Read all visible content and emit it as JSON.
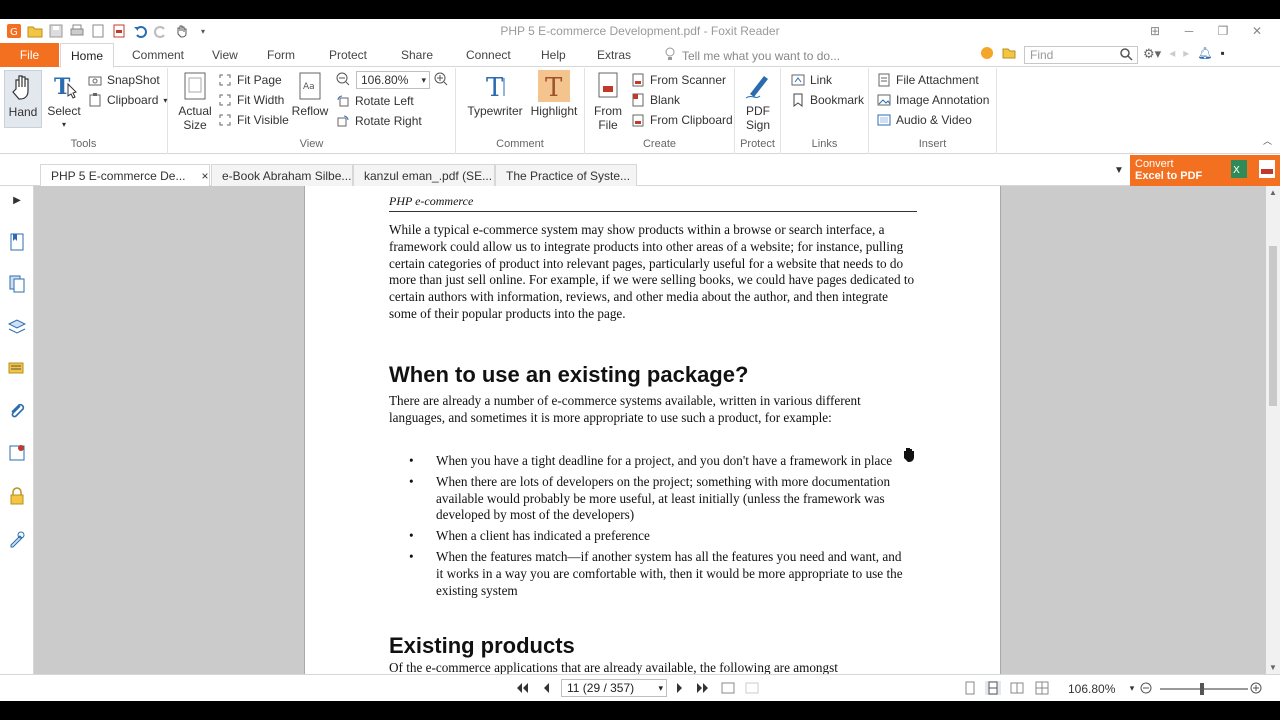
{
  "window": {
    "title": "PHP 5 E-commerce Development.pdf - Foxit Reader"
  },
  "menu": {
    "file": "File",
    "tabs": [
      "Home",
      "Comment",
      "View",
      "Form",
      "Protect",
      "Share",
      "Connect",
      "Help",
      "Extras"
    ],
    "tell_me": "Tell me what you want to do...",
    "find_placeholder": "Find"
  },
  "ribbon": {
    "tools": {
      "label": "Tools",
      "hand": "Hand",
      "select": "Select",
      "snapshot": "SnapShot",
      "clipboard": "Clipboard"
    },
    "view": {
      "label": "View",
      "actual_size_1": "Actual",
      "actual_size_2": "Size",
      "fit_page": "Fit Page",
      "fit_width": "Fit Width",
      "fit_visible": "Fit Visible",
      "reflow": "Reflow",
      "zoom": "106.80%",
      "rotate_left": "Rotate Left",
      "rotate_right": "Rotate Right"
    },
    "comment": {
      "label": "Comment",
      "typewriter": "Typewriter",
      "highlight": "Highlight"
    },
    "create": {
      "label": "Create",
      "from_file_1": "From",
      "from_file_2": "File",
      "from_scanner": "From Scanner",
      "blank": "Blank",
      "from_clipboard": "From Clipboard"
    },
    "protect": {
      "label": "Protect",
      "pdf_sign_1": "PDF",
      "pdf_sign_2": "Sign"
    },
    "links": {
      "label": "Links",
      "link": "Link",
      "bookmark": "Bookmark"
    },
    "insert": {
      "label": "Insert",
      "file_attachment": "File Attachment",
      "image_annotation": "Image Annotation",
      "audio_video": "Audio & Video"
    }
  },
  "doc_tabs": [
    {
      "label": "PHP 5 E-commerce De...",
      "close": "×"
    },
    {
      "label": "e-Book Abraham Silbe..."
    },
    {
      "label": "kanzul eman_.pdf (SE..."
    },
    {
      "label": "The Practice of Syste..."
    }
  ],
  "convert_banner": {
    "line1": "Convert",
    "line2": "Excel to PDF"
  },
  "document": {
    "running_head": "PHP e-commerce",
    "para1": "While a typical e-commerce system may show products within a browse or search interface, a framework could allow us to integrate products into other areas of a website; for instance, pulling certain categories of product into relevant pages, particularly useful for a website that needs to do more than just sell online. For example, if we were selling books, we could have pages dedicated to certain authors with information, reviews, and other media about the author, and then integrate some of their popular products into the page.",
    "heading1": "When to use an existing package?",
    "para2": "There are already a number of e-commerce systems available, written in various different languages, and sometimes it is more appropriate to use such a product, for example:",
    "bullets": [
      "When you have a tight deadline for a project, and you don't have a framework in place",
      "When there are lots of developers on the project; something with more documentation available would probably be more useful, at least initially (unless the framework was developed by most of the developers)",
      "When a client has indicated a preference",
      "When the features match—if another system has all the features you need and want, and it works in a way you are comfortable with, then it would be more appropriate to use the existing system"
    ],
    "heading2": "Existing products",
    "para3": "Of the e-commerce applications that are already available, the following are amongst"
  },
  "status": {
    "page": "11 (29 / 357)",
    "zoom": "106.80%"
  },
  "colors": {
    "accent": "#f37021",
    "workspace": "#cbcbcb"
  }
}
